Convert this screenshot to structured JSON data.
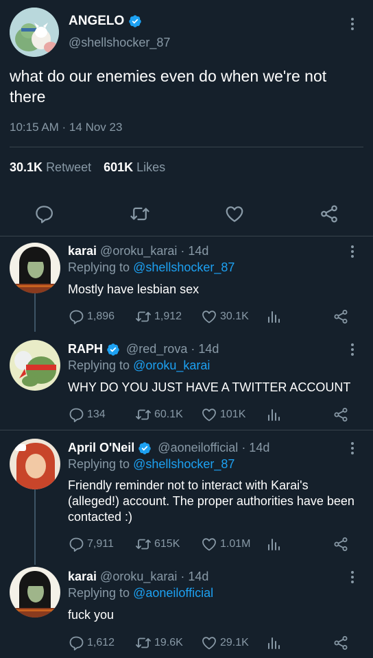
{
  "main_tweet": {
    "author_name": "ANGELO",
    "author_handle": "@shellshocker_87",
    "verified": true,
    "text": "what do our enemies even do when we're not there",
    "timestamp": "10:15 AM · 14 Nov 23",
    "retweets_count": "30.1K",
    "retweets_label": "Retweet",
    "likes_count": "601K",
    "likes_label": "Likes",
    "actions": [
      "reply-icon",
      "retweet-icon",
      "like-icon",
      "share-icon"
    ]
  },
  "replies": [
    {
      "name": "karai",
      "handle": "@oroku_karai",
      "time": "· 14d",
      "verified": false,
      "replying_prefix": "Replying to",
      "replying_to": "@shellshocker_87",
      "text": "Mostly have lesbian sex",
      "replies": "1,896",
      "retweets": "1,912",
      "likes": "30.1K"
    },
    {
      "name": "RAPH",
      "handle": "@red_rova",
      "time": "· 14d",
      "verified": true,
      "replying_prefix": "Replying to",
      "replying_to": "@oroku_karai",
      "text": "WHY DO YOU JUST HAVE A TWITTER ACCOUNT",
      "replies": "134",
      "retweets": "60.1K",
      "likes": "101K"
    },
    {
      "name": "April O'Neil",
      "handle": "@aoneilofficial",
      "time": "· 14d",
      "verified": true,
      "replying_prefix": "Replying to",
      "replying_to": "@shellshocker_87",
      "text": "Friendly reminder not to interact with Karai's (alleged!) account. The proper authorities have been contacted :)",
      "replies": "7,911",
      "retweets": "615K",
      "likes": "1.01M"
    },
    {
      "name": "karai",
      "handle": "@oroku_karai",
      "time": "· 14d",
      "verified": false,
      "replying_prefix": "Replying to",
      "replying_to": "@aoneilofficial",
      "text": "fuck you",
      "replies": "1,612",
      "retweets": "19.6K",
      "likes": "29.1K"
    }
  ],
  "colors": {
    "background": "#15202b",
    "secondary_text": "#8899a6",
    "link": "#1da1f2",
    "divider": "#38444d"
  }
}
